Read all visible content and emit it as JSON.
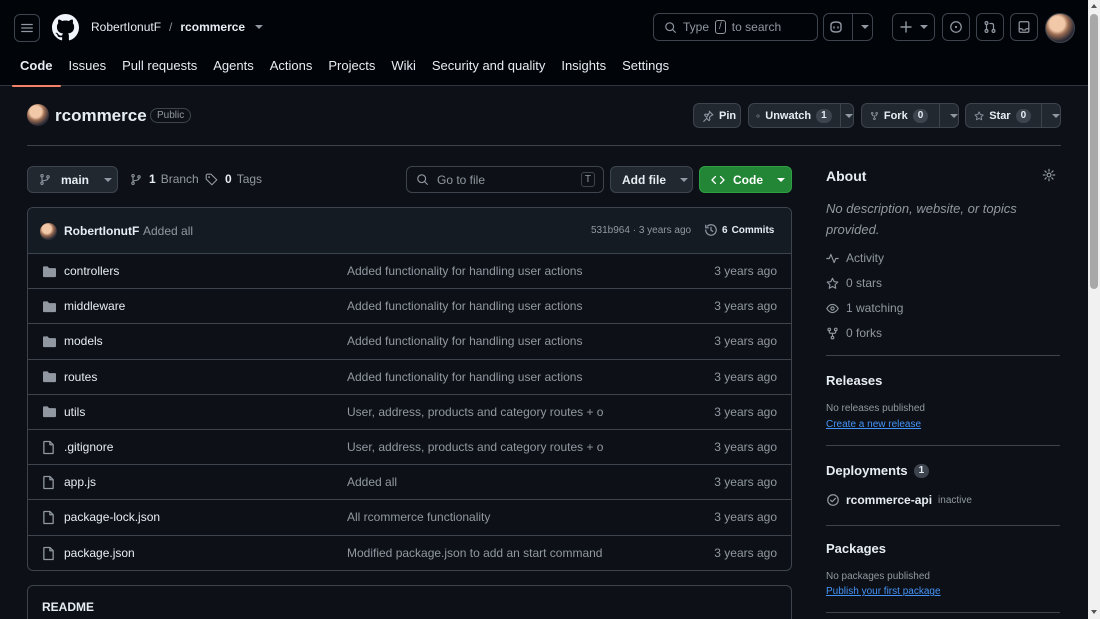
{
  "header": {
    "owner": "RobertIonutF",
    "separator": "/",
    "repo": "rcommerce",
    "search": {
      "prefix": "Type",
      "key": "/",
      "suffix": "to search"
    }
  },
  "tabs": [
    {
      "label": "Code",
      "active": true
    },
    {
      "label": "Issues"
    },
    {
      "label": "Pull requests"
    },
    {
      "label": "Agents"
    },
    {
      "label": "Actions"
    },
    {
      "label": "Projects"
    },
    {
      "label": "Wiki"
    },
    {
      "label": "Security and quality"
    },
    {
      "label": "Insights"
    },
    {
      "label": "Settings"
    }
  ],
  "repo": {
    "name": "rcommerce",
    "visibility": "Public",
    "pin": "Pin",
    "unwatch": "Unwatch",
    "watch_count": "1",
    "fork": "Fork",
    "fork_count": "0",
    "star": "Star",
    "star_count": "0"
  },
  "toolbar": {
    "branch": "main",
    "branch_count": "1",
    "branch_label": "Branch",
    "tag_count": "0",
    "tag_label": "Tags",
    "goto_placeholder": "Go to file",
    "goto_key": "T",
    "add_file": "Add file",
    "code": "Code"
  },
  "latest_commit": {
    "author": "RobertIonutF",
    "message": "Added all",
    "meta": "531b964 · 3 years ago",
    "commits_count": "6",
    "commits_label": "Commits"
  },
  "files": [
    {
      "type": "dir",
      "name": "controllers",
      "message": "Added functionality for handling user actions",
      "date": "3 years ago"
    },
    {
      "type": "dir",
      "name": "middleware",
      "message": "Added functionality for handling user actions",
      "date": "3 years ago"
    },
    {
      "type": "dir",
      "name": "models",
      "message": "Added functionality for handling user actions",
      "date": "3 years ago"
    },
    {
      "type": "dir",
      "name": "routes",
      "message": "Added functionality for handling user actions",
      "date": "3 years ago"
    },
    {
      "type": "dir",
      "name": "utils",
      "message": "User, address, products and category routes + o",
      "date": "3 years ago"
    },
    {
      "type": "file",
      "name": ".gitignore",
      "message": "User, address, products and category routes + o",
      "date": "3 years ago"
    },
    {
      "type": "file",
      "name": "app.js",
      "message": "Added all",
      "date": "3 years ago"
    },
    {
      "type": "file",
      "name": "package-lock.json",
      "message": "All rcommerce functionality",
      "date": "3 years ago"
    },
    {
      "type": "file",
      "name": "package.json",
      "message": "Modified package.json to add an start command",
      "date": "3 years ago"
    }
  ],
  "readme": {
    "title": "README"
  },
  "about": {
    "title": "About",
    "description": "No description, website, or topics provided.",
    "activity": "Activity",
    "stars": "0 stars",
    "watching": "1 watching",
    "forks": "0 forks"
  },
  "releases": {
    "title": "Releases",
    "empty": "No releases published",
    "link": "Create a new release"
  },
  "deployments": {
    "title": "Deployments",
    "count": "1",
    "env": "rcommerce-api",
    "status": "inactive"
  },
  "packages": {
    "title": "Packages",
    "empty": "No packages published",
    "link": "Publish your first package"
  },
  "colors": {
    "accent": "#238636",
    "link": "#4493f8",
    "tab_underline": "#f78166",
    "bg": "#0d1117",
    "header_bg": "#010409",
    "border": "#3d444d"
  }
}
